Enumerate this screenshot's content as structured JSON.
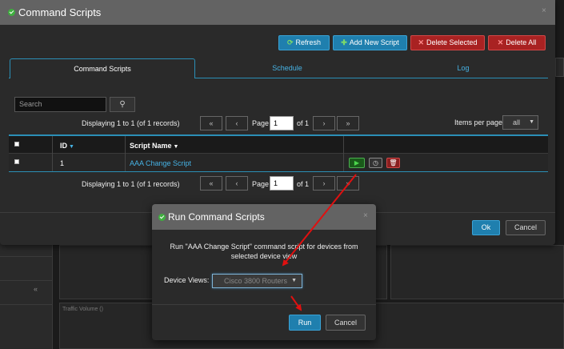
{
  "main_dialog": {
    "title": "Command Scripts",
    "close_label": "×",
    "toolbar": {
      "refresh": "Refresh",
      "add": "Add New Script",
      "delete_selected": "Delete Selected",
      "delete_all": "Delete All"
    },
    "tabs": [
      "Command Scripts",
      "Schedule",
      "Log"
    ],
    "search": {
      "placeholder": "Search",
      "button_icon": "search-icon"
    },
    "pagination_top": {
      "displaying": "Displaying 1 to 1 (of 1 records)",
      "page_label": "Page",
      "page_value": "1",
      "of_label": "of 1",
      "first": "«",
      "prev": "‹",
      "next": "›",
      "last": "»"
    },
    "pagination_bottom": {
      "displaying": "Displaying 1 to 1 (of 1 records)",
      "page_label": "Page",
      "page_value": "1",
      "of_label": "of 1",
      "first": "«",
      "prev": "‹",
      "next": "›",
      "last": "»"
    },
    "items_per_page": {
      "label": "Items per page",
      "value": "all"
    },
    "table": {
      "columns": [
        "ID",
        "Script Name"
      ],
      "rows": [
        {
          "id": "1",
          "name": "AAA Change Script"
        }
      ]
    },
    "ok": "Ok",
    "cancel": "Cancel"
  },
  "modal": {
    "title": "Run Command Scripts",
    "close_label": "×",
    "message": "Run \"AAA Change Script\" command script for devices from selected device view",
    "device_views_label": "Device Views:",
    "device_views_value": "Cisco 3800 Routers",
    "run": "Run",
    "cancel": "Cancel"
  },
  "background": {
    "panel_label": "Traffic Volume ()",
    "chevron": "«"
  },
  "colors": {
    "accent_blue": "#1f7fae",
    "danger_red": "#a92222",
    "link_blue": "#46b2e4",
    "annotation_red": "#e01010"
  }
}
